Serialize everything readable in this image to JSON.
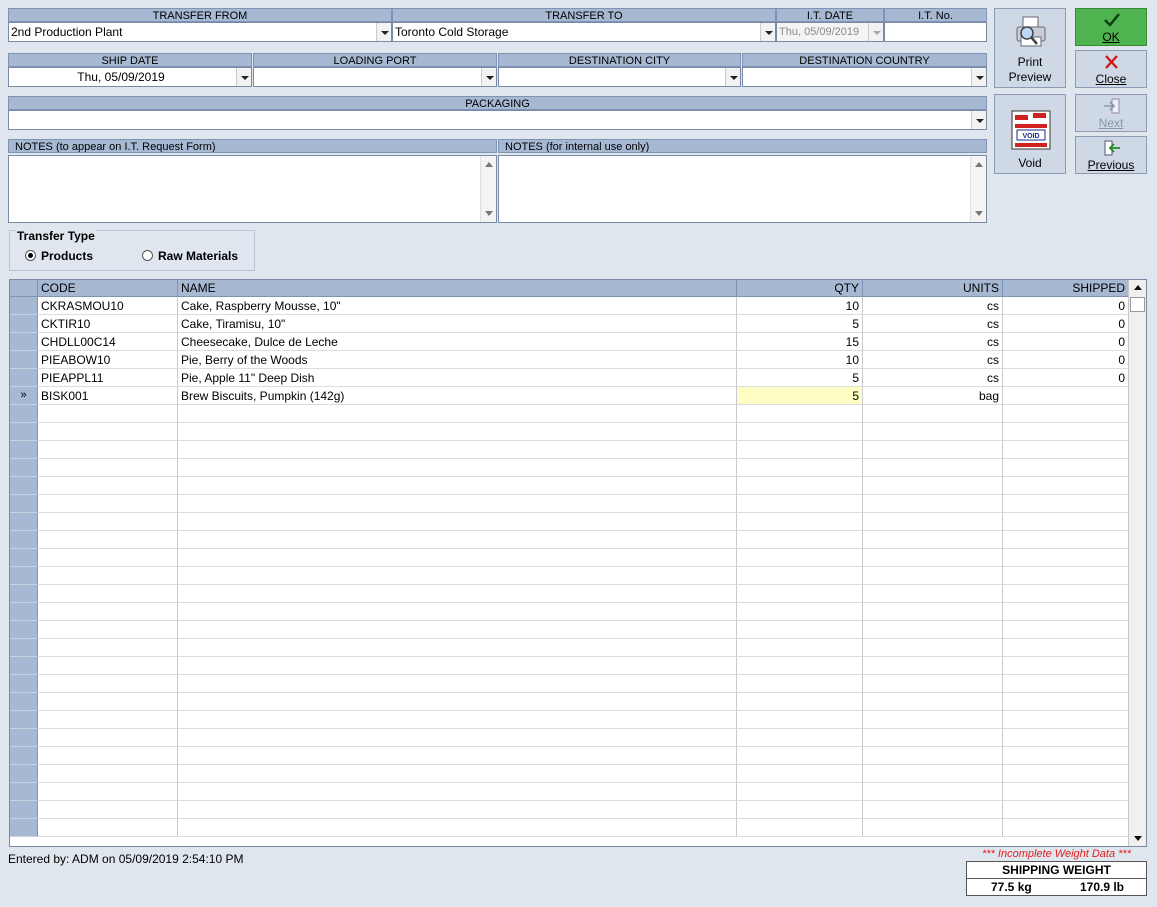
{
  "header": {
    "transfer_from": {
      "label": "TRANSFER FROM",
      "value": "2nd Production Plant"
    },
    "transfer_to": {
      "label": "TRANSFER TO",
      "value": "Toronto Cold Storage"
    },
    "it_date": {
      "label": "I.T. DATE",
      "value": "Thu, 05/09/2019"
    },
    "it_no": {
      "label": "I.T. No.",
      "value": ""
    },
    "ship_date": {
      "label": "SHIP DATE",
      "value": "Thu, 05/09/2019"
    },
    "loading_port": {
      "label": "LOADING PORT",
      "value": ""
    },
    "destination_city": {
      "label": "DESTINATION CITY",
      "value": ""
    },
    "destination_country": {
      "label": "DESTINATION COUNTRY",
      "value": ""
    },
    "packaging": {
      "label": "PACKAGING",
      "value": ""
    },
    "notes_form": {
      "label": "NOTES (to appear on I.T. Request Form)",
      "value": ""
    },
    "notes_internal": {
      "label": "NOTES (for internal use only)",
      "value": ""
    }
  },
  "buttons": {
    "print_preview": {
      "line1": "Print",
      "line2": "Preview"
    },
    "void": {
      "label": "Void",
      "badge": "VOID"
    },
    "ok": {
      "label": "OK"
    },
    "close": {
      "label": "Close"
    },
    "next": {
      "label": "Next"
    },
    "previous": {
      "label": "Previous"
    }
  },
  "transfer_type": {
    "title": "Transfer Type",
    "options": [
      "Products",
      "Raw Materials"
    ],
    "selected": "Products"
  },
  "grid": {
    "columns": [
      "CODE",
      "NAME",
      "QTY",
      "UNITS",
      "SHIPPED"
    ],
    "current_row_marker": "»",
    "rows": [
      {
        "code": "CKRASMOU10",
        "name": "Cake, Raspberry Mousse, 10\"",
        "qty": "10",
        "units": "cs",
        "shipped": "0"
      },
      {
        "code": "CKTIR10",
        "name": "Cake, Tiramisu, 10\"",
        "qty": "5",
        "units": "cs",
        "shipped": "0"
      },
      {
        "code": "CHDLL00C14",
        "name": "Cheesecake, Dulce de Leche",
        "qty": "15",
        "units": "cs",
        "shipped": "0"
      },
      {
        "code": "PIEABOW10",
        "name": "Pie, Berry of the Woods",
        "qty": "10",
        "units": "cs",
        "shipped": "0"
      },
      {
        "code": "PIEAPPL11",
        "name": "Pie, Apple 11\" Deep Dish",
        "qty": "5",
        "units": "cs",
        "shipped": "0"
      },
      {
        "code": "BISK001",
        "name": "Brew Biscuits, Pumpkin (142g)",
        "qty": "5",
        "units": "bag",
        "shipped": ""
      }
    ]
  },
  "footer": {
    "entered_by": "Entered by: ADM on 05/09/2019 2:54:10 PM",
    "warning": "*** Incomplete Weight Data ***",
    "shipping_weight_title": "SHIPPING WEIGHT",
    "weight_kg": "77.5 kg",
    "weight_lb": "170.9 lb"
  },
  "colors": {
    "background": "#dfe6ee",
    "header": "#a6b8d2",
    "ok_button": "#4fb34f",
    "edit_cell": "#ffffc4",
    "warning_text": "#e02020"
  }
}
